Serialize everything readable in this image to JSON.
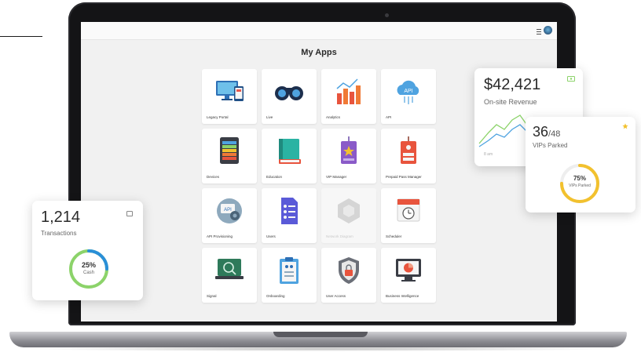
{
  "window": {
    "title": "My Apps"
  },
  "apps": [
    {
      "label": "Legacy Portal",
      "icon": "monitor-devices-icon"
    },
    {
      "label": "Live",
      "icon": "binoculars-icon"
    },
    {
      "label": "Analytics",
      "icon": "bar-chart-icon"
    },
    {
      "label": "API",
      "icon": "cloud-api-icon"
    },
    {
      "label": "Devices",
      "icon": "tablet-devices-icon"
    },
    {
      "label": "Education",
      "icon": "book-icon"
    },
    {
      "label": "VIP Manager",
      "icon": "vip-badge-icon"
    },
    {
      "label": "Prepaid Pass Manager",
      "icon": "pass-tag-icon"
    },
    {
      "label": "API Provisioning",
      "icon": "api-gear-icon"
    },
    {
      "label": "Users",
      "icon": "users-document-icon"
    },
    {
      "label": "Network Diagram",
      "icon": "network-diagram-icon",
      "disabled": true
    },
    {
      "label": "Scheduler",
      "icon": "calendar-clock-icon"
    },
    {
      "label": "Signal",
      "icon": "signal-monitor-icon"
    },
    {
      "label": "Onboarding",
      "icon": "clipboard-icon"
    },
    {
      "label": "User Access",
      "icon": "shield-lock-icon"
    },
    {
      "label": "Business Intelligence",
      "icon": "bi-monitor-icon"
    }
  ],
  "cards": {
    "revenue": {
      "value": "$42,421",
      "label": "On-site Revenue",
      "time_label": "8 am",
      "icon": "cash-icon"
    },
    "vip": {
      "value": "36",
      "total": "/48",
      "label": "VIPs Parked",
      "ring_value": "75%",
      "ring_label": "VIPs Parked",
      "ring_fraction": 0.75,
      "icon": "star-icon",
      "color": "#f2c12e"
    },
    "transactions": {
      "value": "1,214",
      "label": "Transactions",
      "ring_value": "25%",
      "ring_label": "Cash",
      "ring_fraction": 0.25,
      "icon": "card-icon",
      "color": "#2a8fd8"
    }
  },
  "colors": {
    "line_green": "#8cd36a",
    "line_blue": "#4fa3e0",
    "ring_track": "#eeeeee"
  }
}
